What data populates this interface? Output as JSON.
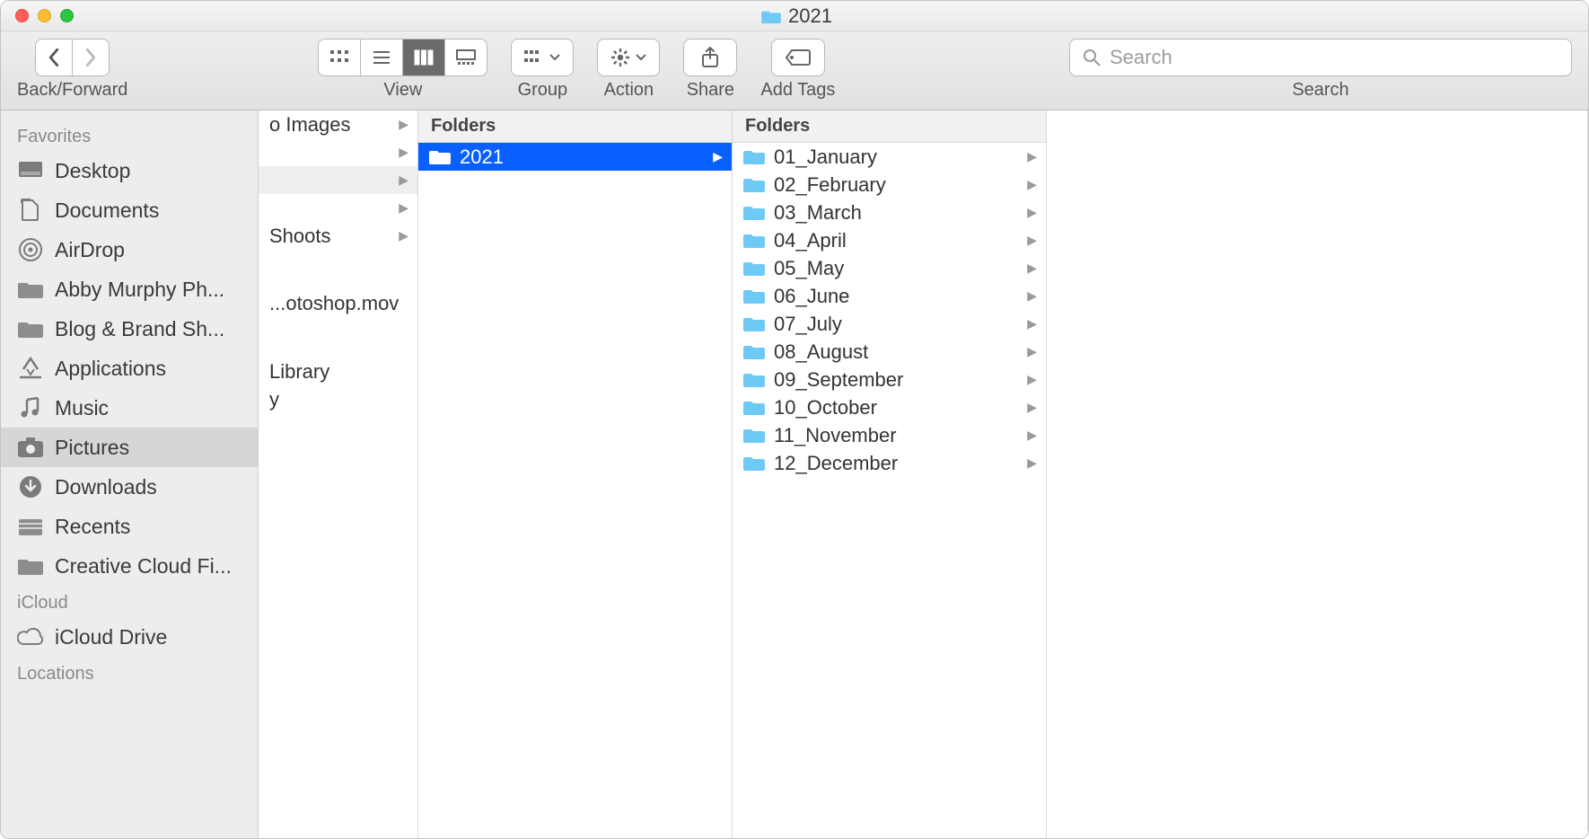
{
  "window": {
    "title": "2021"
  },
  "toolbar": {
    "back_forward_label": "Back/Forward",
    "view_label": "View",
    "group_label": "Group",
    "action_label": "Action",
    "share_label": "Share",
    "add_tags_label": "Add Tags",
    "search_label": "Search",
    "search_placeholder": "Search"
  },
  "sidebar": {
    "sections": [
      {
        "title": "Favorites",
        "items": [
          {
            "label": "Desktop",
            "icon": "desktop",
            "selected": false
          },
          {
            "label": "Documents",
            "icon": "documents",
            "selected": false
          },
          {
            "label": "AirDrop",
            "icon": "airdrop",
            "selected": false
          },
          {
            "label": "Abby Murphy Ph...",
            "icon": "folder",
            "selected": false
          },
          {
            "label": "Blog & Brand Sh...",
            "icon": "folder",
            "selected": false
          },
          {
            "label": "Applications",
            "icon": "applications",
            "selected": false
          },
          {
            "label": "Music",
            "icon": "music",
            "selected": false
          },
          {
            "label": "Pictures",
            "icon": "pictures",
            "selected": true
          },
          {
            "label": "Downloads",
            "icon": "downloads",
            "selected": false
          },
          {
            "label": "Recents",
            "icon": "recents",
            "selected": false
          },
          {
            "label": "Creative Cloud Fi...",
            "icon": "folder",
            "selected": false
          }
        ]
      },
      {
        "title": "iCloud",
        "items": [
          {
            "label": "iCloud Drive",
            "icon": "cloud",
            "selected": false
          }
        ]
      },
      {
        "title": "Locations",
        "items": []
      }
    ]
  },
  "columns": {
    "col0": {
      "items": [
        {
          "label": "o Images",
          "arrow": true
        },
        {
          "label": "",
          "arrow": true
        },
        {
          "label": "",
          "arrow": true,
          "shaded": true
        },
        {
          "label": "",
          "arrow": true
        },
        {
          "label": "Shoots",
          "arrow": true
        },
        {
          "label": "",
          "arrow": false,
          "tall": true
        },
        {
          "label": "...otoshop.mov",
          "arrow": false,
          "tall": true
        },
        {
          "label": "",
          "arrow": false,
          "tall": true
        },
        {
          "label": "Library",
          "arrow": false
        },
        {
          "label": "y",
          "arrow": false
        }
      ]
    },
    "col1": {
      "header": "Folders",
      "items": [
        {
          "label": "2021",
          "arrow": true,
          "selected": true
        }
      ]
    },
    "col2": {
      "header": "Folders",
      "items": [
        {
          "label": "01_January",
          "arrow": true
        },
        {
          "label": "02_February",
          "arrow": true
        },
        {
          "label": "03_March",
          "arrow": true
        },
        {
          "label": "04_April",
          "arrow": true
        },
        {
          "label": "05_May",
          "arrow": true
        },
        {
          "label": "06_June",
          "arrow": true
        },
        {
          "label": "07_July",
          "arrow": true
        },
        {
          "label": "08_August",
          "arrow": true
        },
        {
          "label": "09_September",
          "arrow": true
        },
        {
          "label": "10_October",
          "arrow": true
        },
        {
          "label": "11_November",
          "arrow": true
        },
        {
          "label": "12_December",
          "arrow": true
        }
      ]
    }
  }
}
